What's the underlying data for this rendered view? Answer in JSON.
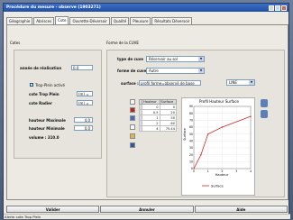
{
  "window": {
    "title": "Procédure du mesure - observe (1903271)"
  },
  "tabs": [
    {
      "label": "Géographie"
    },
    {
      "label": "Abrisces"
    },
    {
      "label": "Cote"
    },
    {
      "label": "Ouvrette-Déversoir"
    },
    {
      "label": "Qualité"
    },
    {
      "label": "Pleusure"
    },
    {
      "label": "Résultats Déversoir"
    }
  ],
  "cotes": {
    "group_title": "Cotes",
    "annee_label": "année de réalisation",
    "annee_value": "0.0",
    "trop_plein_check_label": "Trop-Plein activé",
    "cote_trop_plein_label": "cote Trop Plein",
    "cote_trop_plein_value": "(m) =",
    "cote_radier_label": "cote Radier",
    "cote_radier_value": "(m) =",
    "hauteur_max_label": "hauteur Maximale",
    "hauteur_max_value": "4.0",
    "hauteur_min_label": "hauteur Minimale",
    "hauteur_min_value": "0.0",
    "volume_text": "volume : 310.0"
  },
  "forme": {
    "group_title": "Forme de la CUVE",
    "type_cuve_label": "type de cuve",
    "type_cuve_value": "Réservoir au sol",
    "forme_cuve_label": "forme de cuve",
    "forme_cuve_value": "Autre",
    "surface_label": "surface :",
    "surface_value": "profil forme=observé de base",
    "lineaire_value": "LINE"
  },
  "table": {
    "headers": [
      "Hauteur",
      "Surface"
    ],
    "rows": [
      {
        "hauteur": "0",
        "surface": "0"
      },
      {
        "hauteur": "0.5",
        "surface": "20"
      },
      {
        "hauteur": "1",
        "surface": "50"
      },
      {
        "hauteur": "2",
        "surface": "60"
      },
      {
        "hauteur": "4",
        "surface": "75.44"
      }
    ]
  },
  "chart_data": {
    "type": "line",
    "title": "Profil Hauteur Surface",
    "xlabel": "Hauteur",
    "ylabel": "Surface",
    "x": [
      0,
      0.5,
      1,
      2,
      4
    ],
    "series": [
      {
        "name": "Surface",
        "values": [
          0,
          20,
          50,
          60,
          75.44
        ]
      }
    ],
    "xlim": [
      0,
      4
    ],
    "ylim": [
      0,
      90
    ],
    "xticks": [
      "0",
      "1",
      "2",
      "3",
      "4"
    ],
    "yticks": [
      "0",
      "10",
      "20",
      "30",
      "40",
      "50",
      "60",
      "70",
      "80",
      "90"
    ],
    "grid": true,
    "legend_position": "bottom",
    "line_color": "#d62728"
  },
  "buttons": {
    "valider": "Valider",
    "annuler": "Annuler",
    "aide": "Aide"
  },
  "status": {
    "text": "Alerte cote Trop Plein"
  },
  "colors": {
    "titlebar": "#1f4fa2",
    "accent": "#d62728"
  }
}
